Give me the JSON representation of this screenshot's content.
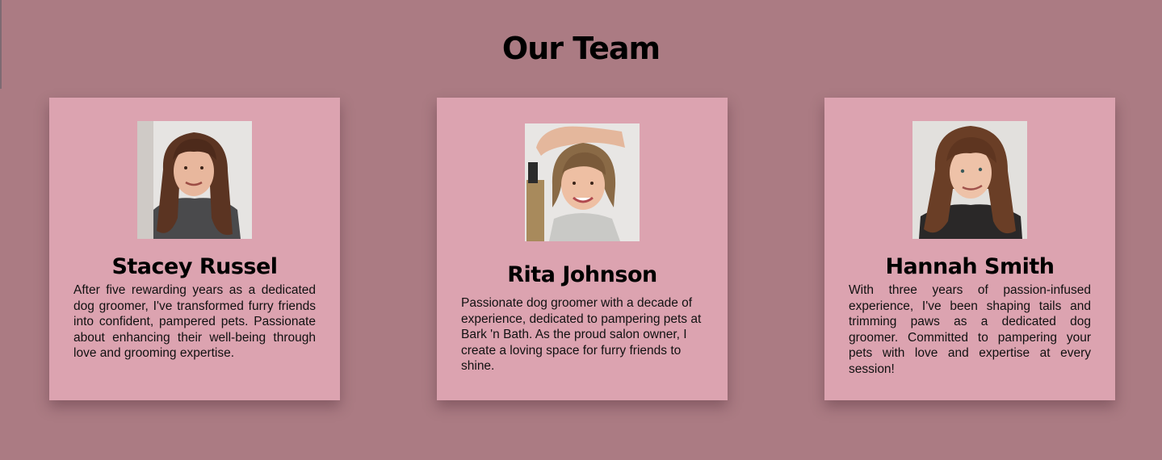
{
  "section": {
    "title": "Our Team"
  },
  "team": [
    {
      "name": "Stacey Russel",
      "bio": "After five rewarding years as a dedicated dog groomer, I've transformed furry friends into confident, pampered pets. Passionate about enhancing their well-being through love and grooming expertise.",
      "photo": "portrait-stacey-russel"
    },
    {
      "name": "Rita Johnson",
      "bio": "Passionate dog groomer with a decade of experience, dedicated to pampering pets at Bark 'n Bath. As the proud salon owner, I create a loving space for furry friends to shine.",
      "photo": "portrait-rita-johnson"
    },
    {
      "name": "Hannah Smith",
      "bio": "With three years of passion-infused experience, I've been shaping tails and trimming paws as a dedicated dog groomer. Committed to pampering your pets with love and expertise at every session!",
      "photo": "portrait-hannah-smith"
    }
  ],
  "colors": {
    "background": "#ab7b83",
    "card": "#dca3b0",
    "text": "#000000"
  }
}
